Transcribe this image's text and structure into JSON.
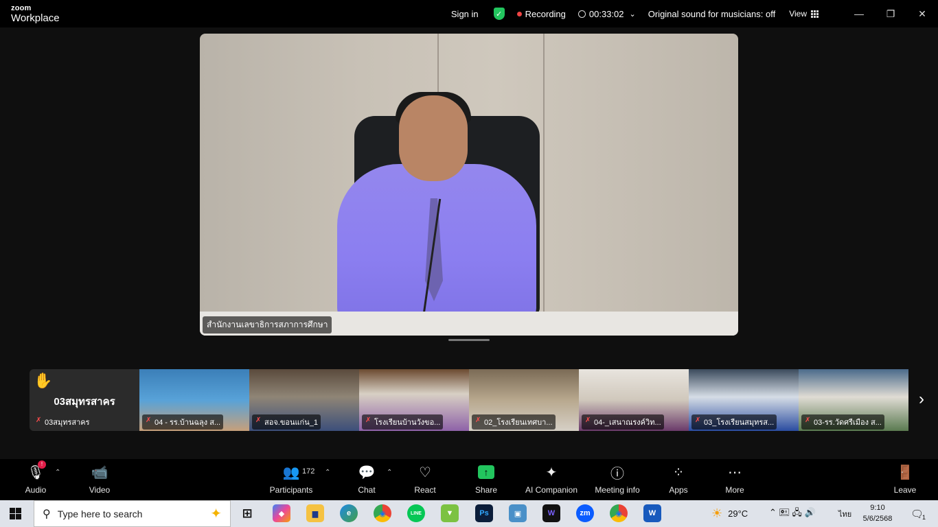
{
  "titlebar": {
    "brand_top": "zoom",
    "brand_bottom": "Workplace",
    "sign_in": "Sign in",
    "shield_glyph": "✓",
    "recording": "Recording",
    "timer": "00:33:02",
    "timer_caret": "⌄",
    "original_sound": "Original sound for musicians: off",
    "view": "View",
    "minimize_glyph": "—",
    "restore_glyph": "❐",
    "close_glyph": "✕"
  },
  "main_video": {
    "name": "สำนักงานเลขาธิการสภาการศึกษา"
  },
  "thumbnails": {
    "raised_hand_glyph": "✋",
    "mute_glyph": "✗",
    "next_glyph": "›",
    "first_name_big": "03สมุทรสาคร",
    "first_label": "03สมุทรสาคร",
    "tiles": [
      {
        "label": "04 - รร.บ้านฉลุง ส..."
      },
      {
        "label": "สอจ.ขอนแก่น_1"
      },
      {
        "label": "โรงเรียนบ้านวังขอ..."
      },
      {
        "label": "02_โรงเรียนเทศบา..."
      },
      {
        "label": "04-_เสนาณรงค์วิท..."
      },
      {
        "label": "03_โรงเรียนสมุทรส..."
      },
      {
        "label": "03-รร.วัดศรีเมือง ส..."
      }
    ]
  },
  "toolbar": {
    "caret_glyph": "⌃",
    "audio": "Audio",
    "audio_icon_glyph": "🎙",
    "audio_badge": "!",
    "video": "Video",
    "video_icon_glyph": "📹",
    "participants": "Participants",
    "participants_icon_glyph": "👥",
    "participants_count": "172",
    "chat": "Chat",
    "chat_icon_glyph": "💬",
    "react": "React",
    "react_icon_glyph": "♡",
    "share": "Share",
    "share_icon_glyph": "↑",
    "ai_companion": "AI Companion",
    "ai_icon_glyph": "✦",
    "meeting_info": "Meeting info",
    "meeting_info_icon_glyph": "ⓘ",
    "apps": "Apps",
    "apps_icon_glyph": "⁘",
    "more": "More",
    "more_icon_glyph": "⋯",
    "leave": "Leave",
    "leave_icon_glyph": "🚪"
  },
  "taskbar": {
    "search_icon_glyph": "⚲",
    "search_placeholder": "Type here to search",
    "search_deco_glyph": "✦",
    "app_glyphs": {
      "task_view": "⊞",
      "copilot": "◆",
      "explorer": "▆",
      "edge": "e",
      "chrome": "◉",
      "line": "LINE",
      "download": "▼",
      "photoshop": "Ps",
      "app": "▣",
      "webex": "W",
      "zoom": "zm",
      "chrome_profile": "◉",
      "word": "W"
    },
    "weather_icon_glyph": "☀",
    "temperature": "29°C",
    "tray_icons_glyph": "⌃  🖭  🖧  🔊",
    "language": "ไทย",
    "time": "9:10",
    "date": "5/6/2568",
    "notification_icon_glyph": "🗨",
    "notification_count": "1"
  },
  "colors": {
    "accent_green": "#22c55e",
    "record_red": "#ef4444",
    "hand_yellow": "#f5b301"
  }
}
